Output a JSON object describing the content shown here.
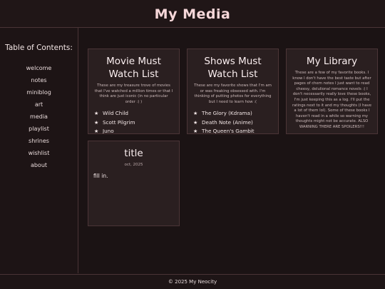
{
  "header": {
    "title": "My Media"
  },
  "sidebar": {
    "title": "Table of Contents:",
    "items": [
      "welcome",
      "notes",
      "miniblog",
      "art",
      "media",
      "playlist",
      "shrines",
      "wishlist",
      "about"
    ]
  },
  "cards": {
    "movies": {
      "title": "Movie Must Watch List",
      "description": "These are my treasure trove of movies that I've watched a million times or that I think are just iconic (in no particular order :) )",
      "items": [
        "Wild Child",
        "Scott Pilgrim",
        "Juno"
      ]
    },
    "shows": {
      "title": "Shows Must Watch List",
      "description": "These are my favorite shows that I'm am or was freaking obsessed with. I'm thinking of putting photos for everything but I need to learn how :(",
      "items": [
        "The Glory (Kdrama)",
        "Death Note (Anime)",
        "The Queen's Gambit"
      ]
    },
    "library": {
      "title": "My Library",
      "description": "These are a few of my favorite books. I know I don't have the best taste but after pages of chem notes I just want to read cheesy, delulional romance novels :) I don't necessarily really love these books, I'm just keeping this as a log. I'll put the ratings next to it and my thoughts (I have a lot of them lol). Some of these books I haven't read in a while so warning my thoughts might not be accurate. ALSO WARNING THERE ARE SPOILERS!!!"
    },
    "post": {
      "title": "title",
      "date": "oct, 2025",
      "body": "fill in."
    }
  },
  "icons": {
    "bullet": "★"
  },
  "footer": {
    "text": "© 2025 My Neocity"
  }
}
